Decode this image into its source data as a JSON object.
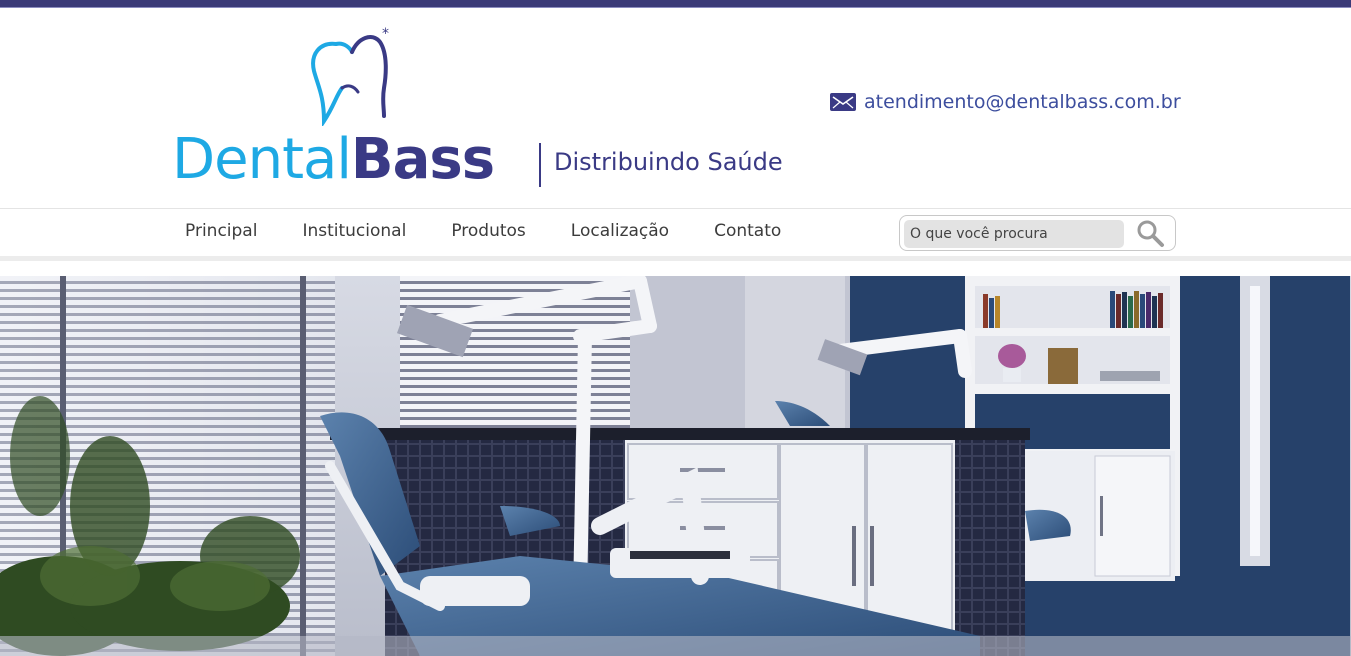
{
  "brand": {
    "name_part1": "Dental",
    "name_part2": "Bass",
    "slogan": "Distribuindo Saúde",
    "colors": {
      "primary": "#3a3a85",
      "secondary": "#1ea9e4"
    }
  },
  "contact": {
    "icon": "mail-icon",
    "email": "atendimento@dentalbass.com.br"
  },
  "nav": {
    "items": [
      {
        "label": "Principal"
      },
      {
        "label": "Institucional"
      },
      {
        "label": "Produtos"
      },
      {
        "label": "Localização"
      },
      {
        "label": "Contato"
      }
    ]
  },
  "search": {
    "placeholder": "O que você procura",
    "value": "",
    "icon": "magnifier-icon"
  },
  "hero": {
    "image": "dental-office-photo"
  }
}
